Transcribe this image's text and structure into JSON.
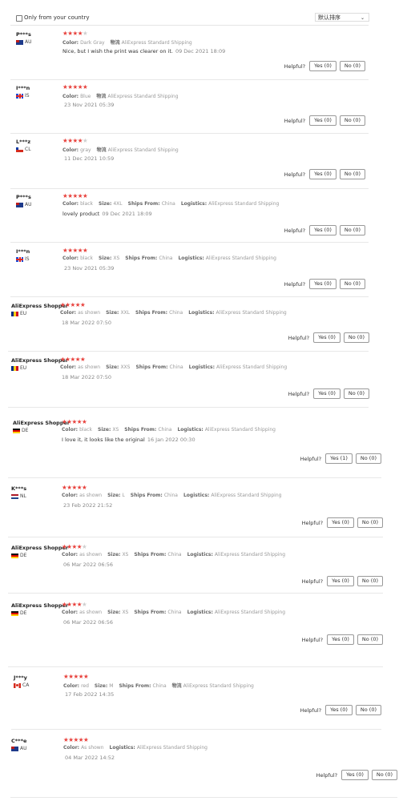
{
  "filter": {
    "only_country_label": "Only from your country"
  },
  "sort": {
    "label": "默认排序"
  },
  "reviews": [
    {
      "name": "P***s",
      "country": "AU",
      "flag": "au",
      "stars": 4,
      "attrs": [
        {
          "k": "Color:",
          "v": "Dark Gray"
        },
        {
          "k": "物流",
          "v": "AliExpress Standard Shipping"
        }
      ],
      "text": "Nice, but I wish the print was clearer on it.",
      "date": "09 Dec 2021 18:09",
      "yes": "Yes (0)",
      "no": "No (0)"
    },
    {
      "name": "I***n",
      "country": "IS",
      "flag": "is",
      "stars": 5,
      "attrs": [
        {
          "k": "Color:",
          "v": "Blue"
        },
        {
          "k": "物流",
          "v": "AliExpress Standard Shipping"
        }
      ],
      "text": "",
      "date": "23 Nov 2021 05:39",
      "yes": "Yes (0)",
      "no": "No (0)"
    },
    {
      "name": "L***z",
      "country": "CL",
      "flag": "cl",
      "stars": 4,
      "attrs": [
        {
          "k": "Color:",
          "v": "gray"
        },
        {
          "k": "物流",
          "v": "AliExpress Standard Shipping"
        }
      ],
      "text": "",
      "date": "11 Dec 2021 10:59",
      "yes": "Yes (0)",
      "no": "No (0)"
    },
    {
      "name": "P***s",
      "country": "AU",
      "flag": "au",
      "stars": 5,
      "attrs": [
        {
          "k": "Color:",
          "v": "black"
        },
        {
          "k": "Size:",
          "v": "4XL"
        },
        {
          "k": "Ships From:",
          "v": "China"
        },
        {
          "k": "Logistics:",
          "v": "AliExpress Standard Shipping"
        }
      ],
      "text": "lovely product",
      "date": "09 Dec 2021 18:09",
      "yes": "Yes (0)",
      "no": "No (0)"
    },
    {
      "name": "I***n",
      "country": "IS",
      "flag": "is",
      "stars": 5,
      "attrs": [
        {
          "k": "Color:",
          "v": "black"
        },
        {
          "k": "Size:",
          "v": "XS"
        },
        {
          "k": "Ships From:",
          "v": "China"
        },
        {
          "k": "Logistics:",
          "v": "AliExpress Standard Shipping"
        }
      ],
      "text": "",
      "date": "23 Nov 2021 05:39",
      "yes": "Yes (0)",
      "no": "No (0)"
    },
    {
      "name": "AliExpress Shopper",
      "country": "EU",
      "flag": "eu",
      "stars": 5,
      "attrs": [
        {
          "k": "Color:",
          "v": "as shown"
        },
        {
          "k": "Size:",
          "v": "XXL"
        },
        {
          "k": "Ships From:",
          "v": "China"
        },
        {
          "k": "Logistics:",
          "v": "AliExpress Standard Shipping"
        }
      ],
      "text": "",
      "date": "18 Mar 2022 07:50",
      "yes": "Yes (0)",
      "no": "No (0)"
    },
    {
      "name": "AliExpress Shopper",
      "country": "EU",
      "flag": "eu",
      "stars": 5,
      "attrs": [
        {
          "k": "Color:",
          "v": "as shown"
        },
        {
          "k": "Size:",
          "v": "XXS"
        },
        {
          "k": "Ships From:",
          "v": "China"
        },
        {
          "k": "Logistics:",
          "v": "AliExpress Standard Shipping"
        }
      ],
      "text": "",
      "date": "18 Mar 2022 07:50",
      "yes": "Yes (0)",
      "no": "No (0)"
    },
    {
      "name": "AliExpress Shopper",
      "country": "DE",
      "flag": "de",
      "stars": 5,
      "attrs": [
        {
          "k": "Color:",
          "v": "black"
        },
        {
          "k": "Size:",
          "v": "XS"
        },
        {
          "k": "Ships From:",
          "v": "China"
        },
        {
          "k": "Logistics:",
          "v": "AliExpress Standard Shipping"
        }
      ],
      "text": "I love it, it looks like the original",
      "date": "16 Jan 2022 00:30",
      "yes": "Yes (1)",
      "no": "No (0)"
    },
    {
      "name": "K***s",
      "country": "NL",
      "flag": "nl",
      "stars": 5,
      "attrs": [
        {
          "k": "Color:",
          "v": "as shown"
        },
        {
          "k": "Size:",
          "v": "L"
        },
        {
          "k": "Ships From:",
          "v": "China"
        },
        {
          "k": "Logistics:",
          "v": "AliExpress Standard Shipping"
        }
      ],
      "text": "",
      "date": "23 Feb 2022 21:52",
      "yes": "Yes (0)",
      "no": "No (0)"
    },
    {
      "name": "AliExpress Shopper",
      "country": "DE",
      "flag": "de",
      "stars": 4,
      "attrs": [
        {
          "k": "Color:",
          "v": "as shown"
        },
        {
          "k": "Size:",
          "v": "XS"
        },
        {
          "k": "Ships From:",
          "v": "China"
        },
        {
          "k": "Logistics:",
          "v": "AliExpress Standard Shipping"
        }
      ],
      "text": "",
      "date": "06 Mar 2022 06:56",
      "yes": "Yes (0)",
      "no": "No (0)"
    },
    {
      "name": "AliExpress Shopper",
      "country": "DE",
      "flag": "de",
      "stars": 4,
      "attrs": [
        {
          "k": "Color:",
          "v": "as shown"
        },
        {
          "k": "Size:",
          "v": "XS"
        },
        {
          "k": "Ships From:",
          "v": "China"
        },
        {
          "k": "Logistics:",
          "v": "AliExpress Standard Shipping"
        }
      ],
      "text": "",
      "date": "06 Mar 2022 06:56",
      "yes": "Yes (0)",
      "no": "No (0)"
    },
    {
      "name": "J***y",
      "country": "CA",
      "flag": "ca",
      "stars": 5,
      "attrs": [
        {
          "k": "Color:",
          "v": "red"
        },
        {
          "k": "Size:",
          "v": "M"
        },
        {
          "k": "Ships From:",
          "v": "China"
        },
        {
          "k": "物流",
          "v": "AliExpress Standard Shipping"
        }
      ],
      "text": "",
      "date": "17 Feb 2022 14:35",
      "yes": "Yes (0)",
      "no": "No (0)"
    },
    {
      "name": "C***e",
      "country": "AU",
      "flag": "au",
      "stars": 5,
      "attrs": [
        {
          "k": "Color:",
          "v": "As shown"
        },
        {
          "k": "Logistics:",
          "v": "AliExpress Standard Shipping"
        }
      ],
      "text": "",
      "date": "04 Mar 2022 14:52",
      "yes": "Yes (0)",
      "no": "No (0)"
    }
  ],
  "labels": {
    "helpful": "Helpful?"
  }
}
